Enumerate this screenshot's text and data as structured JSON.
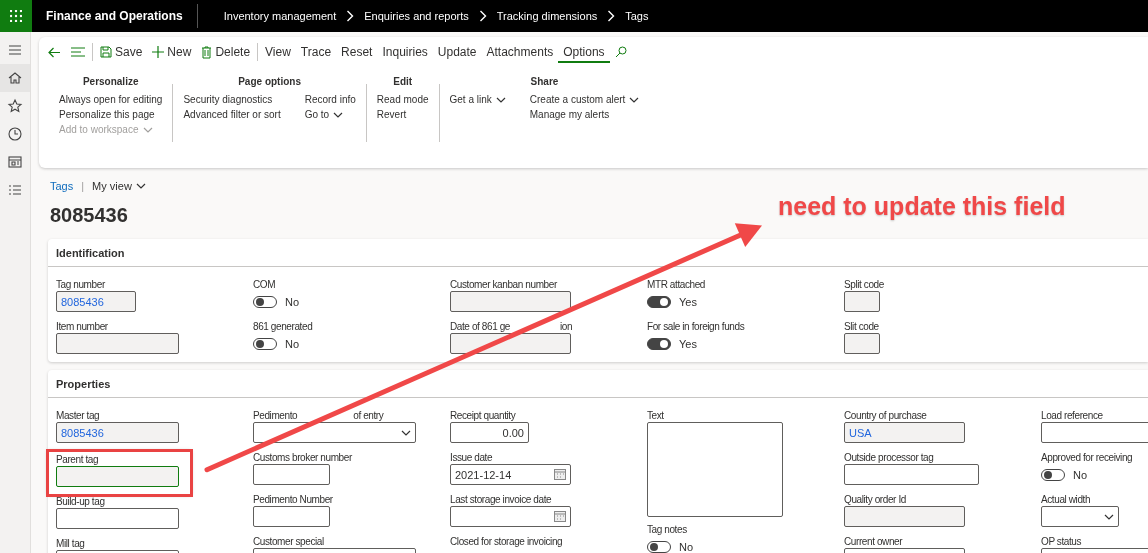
{
  "app": {
    "title": "Finance and Operations"
  },
  "breadcrumb": [
    "Inventory management",
    "Enquiries and reports",
    "Tracking dimensions",
    "Tags"
  ],
  "toolbar": {
    "actions": [
      {
        "label": "Save",
        "kind": "save"
      },
      {
        "label": "New",
        "kind": "new"
      },
      {
        "label": "Delete",
        "kind": "delete"
      }
    ],
    "tabs": [
      {
        "label": "View",
        "selected": false
      },
      {
        "label": "Trace",
        "selected": false
      },
      {
        "label": "Reset",
        "selected": false
      },
      {
        "label": "Inquiries",
        "selected": false
      },
      {
        "label": "Update",
        "selected": false
      },
      {
        "label": "Attachments",
        "selected": false
      },
      {
        "label": "Options",
        "selected": true
      }
    ]
  },
  "option_groups": [
    {
      "title": "Personalize",
      "columns": [
        [
          {
            "label": "Always open for editing",
            "disabled": false,
            "dropdown": false
          },
          {
            "label": "Personalize this page",
            "disabled": false,
            "dropdown": false
          },
          {
            "label": "Add to workspace",
            "disabled": true,
            "dropdown": true
          }
        ]
      ]
    },
    {
      "title": "Page options",
      "columns": [
        [
          {
            "label": "Security diagnostics",
            "disabled": false,
            "dropdown": false
          },
          {
            "label": "Advanced filter or sort",
            "disabled": false,
            "dropdown": false
          }
        ],
        [
          {
            "label": "Record info",
            "disabled": false,
            "dropdown": false
          },
          {
            "label": "Go to",
            "disabled": false,
            "dropdown": true
          }
        ]
      ]
    },
    {
      "title": "Edit",
      "columns": [
        [
          {
            "label": "Read mode",
            "disabled": false,
            "dropdown": false
          },
          {
            "label": "Revert",
            "disabled": false,
            "dropdown": false
          }
        ]
      ]
    },
    {
      "title": "Share",
      "columns": [
        [
          {
            "label": "Get a link",
            "disabled": false,
            "dropdown": true
          }
        ],
        [
          {
            "label": "Create a custom alert",
            "disabled": false,
            "dropdown": true
          },
          {
            "label": "Manage my alerts",
            "disabled": false,
            "dropdown": false
          }
        ]
      ]
    }
  ],
  "page": {
    "breadcrumb_link": "Tags",
    "separator": "|",
    "view": "My view",
    "title": "8085436"
  },
  "sections": [
    {
      "title": "Identification",
      "columns": [
        [
          {
            "label": "Tag number",
            "kind": "text",
            "value": "8085436",
            "link": true,
            "readonly": true,
            "focused": false,
            "annotated": false
          },
          {
            "label": "Item number",
            "kind": "text",
            "readonly": true,
            "focused": false,
            "annotated": false
          }
        ],
        [
          {
            "label": "COM",
            "kind": "toggle",
            "on": false,
            "reading": "No"
          },
          {
            "label": "861 generated",
            "kind": "toggle",
            "on": false,
            "reading": "No"
          }
        ],
        [
          {
            "label": "Customer kanban number",
            "kind": "text",
            "readonly": true,
            "focused": false,
            "annotated": false
          },
          {
            "label": "Date of 861 ge",
            "label_tail": "ion",
            "kind": "text",
            "readonly": true,
            "focused": false,
            "annotated": false
          }
        ],
        [
          {
            "label": "MTR attached",
            "kind": "toggle",
            "on": true,
            "reading": "Yes"
          },
          {
            "label": "For sale in foreign funds",
            "kind": "toggle",
            "on": true,
            "reading": "Yes"
          }
        ],
        [
          {
            "label": "Split code",
            "kind": "text",
            "readonly": true,
            "focused": false,
            "annotated": false
          },
          {
            "label": "Slit code",
            "kind": "text",
            "readonly": true,
            "focused": false,
            "annotated": false
          }
        ]
      ]
    },
    {
      "title": "Properties",
      "columns": [
        [
          {
            "label": "Master tag",
            "kind": "text",
            "value": "8085436",
            "link": true,
            "readonly": true,
            "focused": false,
            "annotated": false
          },
          {
            "label": "Parent tag",
            "kind": "text",
            "readonly": true,
            "focused": true,
            "annotated": true
          },
          {
            "label": "Build-up tag",
            "kind": "text",
            "readonly": false,
            "focused": false,
            "annotated": false
          },
          {
            "label": "Mill tag",
            "kind": "text",
            "readonly": false,
            "focused": false,
            "annotated": false
          }
        ],
        [
          {
            "label": "Pedimento",
            "label_tail": "of entry",
            "kind": "dropdown",
            "readonly": false,
            "focused": false,
            "annotated": false
          },
          {
            "label": "Customs broker number",
            "kind": "text",
            "readonly": false,
            "focused": false,
            "annotated": false
          },
          {
            "label": "Pedimento Number",
            "kind": "text",
            "readonly": false,
            "focused": false,
            "annotated": false
          },
          {
            "label": "Customer special",
            "kind": "text",
            "readonly": false,
            "focused": false,
            "annotated": false
          }
        ],
        [
          {
            "label": "Receipt quantity",
            "kind": "number",
            "value": "0.00",
            "readonly": false,
            "focused": false,
            "annotated": false
          },
          {
            "label": "Issue date",
            "kind": "date",
            "value": "2021-12-14",
            "readonly": false,
            "focused": false,
            "annotated": false
          },
          {
            "label": "Last storage invoice date",
            "kind": "date",
            "readonly": false,
            "focused": false,
            "annotated": false
          },
          {
            "label": "Closed for storage invoicing",
            "kind": "label"
          }
        ],
        [
          {
            "label": "Text",
            "kind": "textarea",
            "readonly": false,
            "focused": false,
            "annotated": false
          },
          {
            "label": "Tag notes",
            "kind": "toggle",
            "on": false,
            "reading": "No"
          }
        ],
        [
          {
            "label": "Country of purchase",
            "kind": "text",
            "value": "USA",
            "link": true,
            "readonly": true,
            "focused": false,
            "annotated": false
          },
          {
            "label": "Outside processor tag",
            "kind": "text",
            "readonly": false,
            "focused": false,
            "annotated": false
          },
          {
            "label": "Quality order Id",
            "kind": "text",
            "readonly": true,
            "focused": false,
            "annotated": false
          },
          {
            "label": "Current owner",
            "kind": "text",
            "readonly": false,
            "focused": false,
            "annotated": false
          }
        ],
        [
          {
            "label": "Load reference",
            "kind": "text",
            "readonly": false,
            "focused": false,
            "annotated": false
          },
          {
            "label": "Approved for receiving",
            "kind": "toggle",
            "on": false,
            "reading": "No"
          },
          {
            "label": "Actual width",
            "kind": "dropdown",
            "readonly": false,
            "focused": false,
            "annotated": false
          },
          {
            "label": "OP status",
            "kind": "text",
            "readonly": false,
            "focused": false,
            "annotated": false
          }
        ]
      ]
    }
  ],
  "annotation": {
    "text": "need to update this field"
  }
}
